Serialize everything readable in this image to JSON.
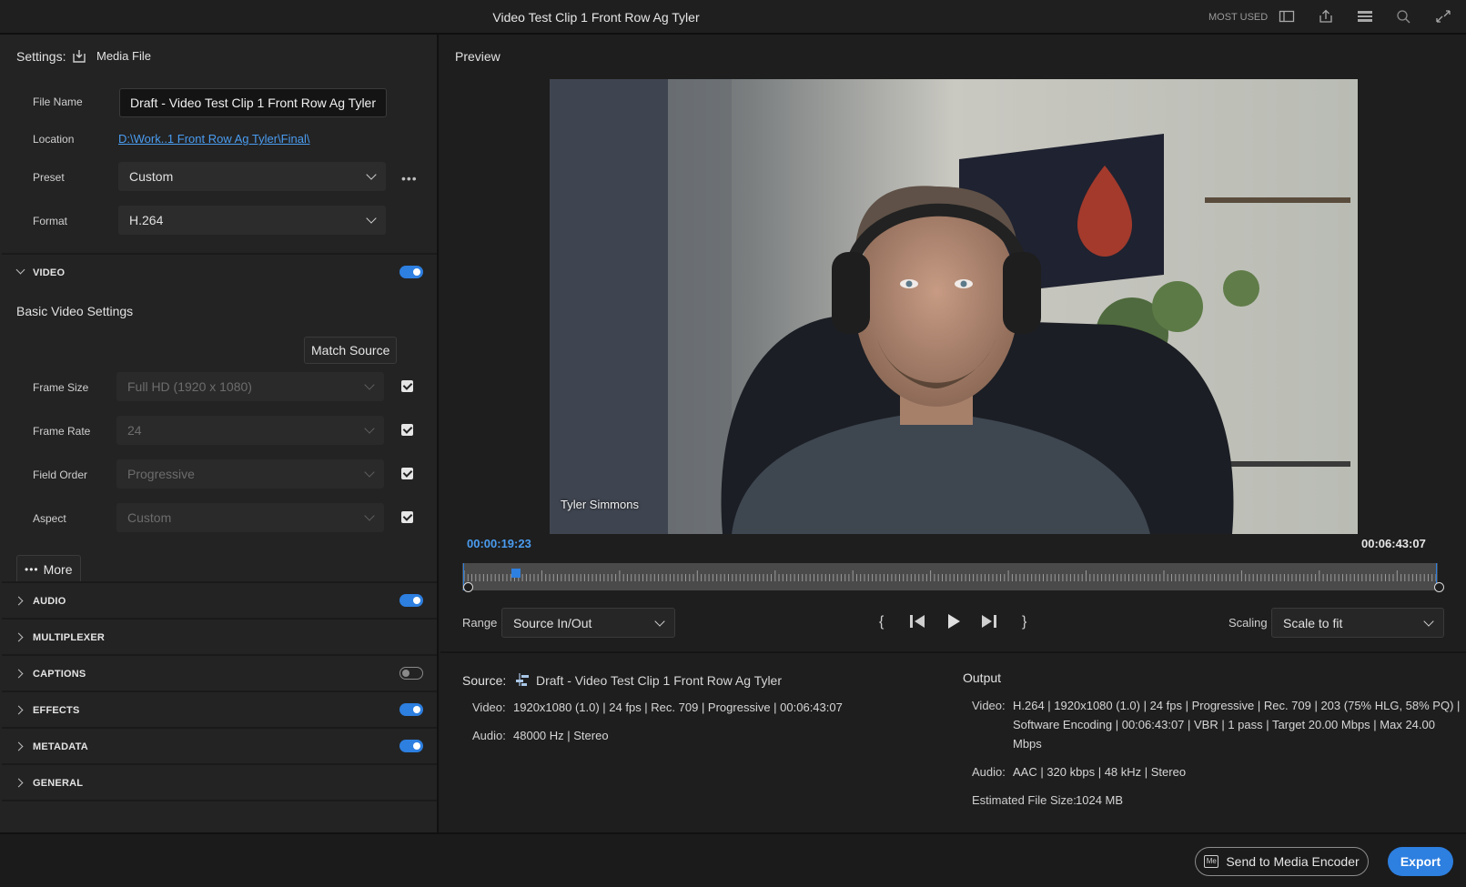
{
  "window": {
    "title": "Video Test Clip 1 Front Row Ag Tyler",
    "most_used": "MOST USED",
    "icons": [
      "panel-icon",
      "share-icon",
      "list-icon",
      "search-icon",
      "fullscreen-icon"
    ]
  },
  "settings": {
    "label": "Settings:",
    "media_file": "Media File",
    "file_name_label": "File Name",
    "file_name_value": "Draft - Video Test Clip 1 Front Row Ag Tyler",
    "location_label": "Location",
    "location_value": "D:\\Work..1 Front Row Ag Tyler\\Final\\",
    "preset_label": "Preset",
    "preset_value": "Custom",
    "format_label": "Format",
    "format_value": "H.264"
  },
  "video_section": {
    "header": "VIDEO",
    "enabled": true,
    "basic_title": "Basic Video Settings",
    "match_source": "Match Source",
    "rows": [
      {
        "label": "Frame Size",
        "value": "Full HD (1920 x 1080)",
        "checked": true
      },
      {
        "label": "Frame Rate",
        "value": "24",
        "checked": true
      },
      {
        "label": "Field Order",
        "value": "Progressive",
        "checked": true
      },
      {
        "label": "Aspect",
        "value": "Custom",
        "checked": true
      }
    ],
    "more": "More"
  },
  "sections": [
    {
      "label": "AUDIO",
      "toggle": "on"
    },
    {
      "label": "MULTIPLEXER",
      "toggle": "none"
    },
    {
      "label": "CAPTIONS",
      "toggle": "off"
    },
    {
      "label": "EFFECTS",
      "toggle": "on"
    },
    {
      "label": "METADATA",
      "toggle": "on"
    },
    {
      "label": "GENERAL",
      "toggle": "none"
    }
  ],
  "preview": {
    "title": "Preview",
    "name_overlay": "Tyler Simmons",
    "current_time": "00:00:19:23",
    "duration": "00:06:43:07",
    "playhead_fraction": 0.05,
    "range_label": "Range",
    "range_value": "Source In/Out",
    "scaling_label": "Scaling",
    "scaling_value": "Scale to fit"
  },
  "source": {
    "label": "Source:",
    "name": "Draft - Video Test Clip 1 Front Row Ag Tyler",
    "video_label": "Video:",
    "video_value": "1920x1080 (1.0) | 24 fps | Rec. 709 | Progressive | 00:06:43:07",
    "audio_label": "Audio:",
    "audio_value": "48000 Hz | Stereo"
  },
  "output": {
    "title": "Output",
    "video_label": "Video:",
    "video_line1": "H.264 | 1920x1080 (1.0) | 24 fps | Progressive | Rec. 709 | 203 (75% HLG, 58% PQ) |",
    "video_line2": "Software Encoding | 00:06:43:07 | VBR | 1 pass | Target 20.00 Mbps | Max 24.00",
    "video_line3": "Mbps",
    "audio_label": "Audio:",
    "audio_value": "AAC | 320 kbps | 48 kHz | Stereo",
    "size_label": "Estimated File Size:",
    "size_value": "1024 MB"
  },
  "footer": {
    "send_label": "Send to Media Encoder",
    "export_label": "Export"
  },
  "colors": {
    "accent": "#2d7fe0",
    "timecode": "#4a9cf0"
  }
}
